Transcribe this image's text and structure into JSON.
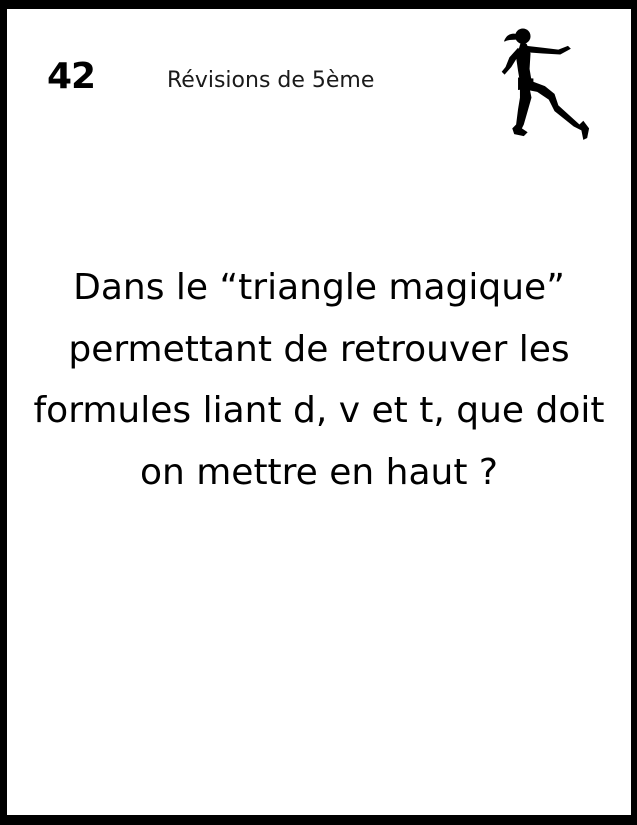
{
  "card": {
    "number": "42",
    "subject": "Révisions de 5ème",
    "question": "Dans le “triangle magique” permettant de retrouver les formules liant d, v et t, que doit on mettre en haut ?",
    "icon": "running-woman-icon",
    "border_color": "#000000",
    "background_color": "#ffffff"
  }
}
